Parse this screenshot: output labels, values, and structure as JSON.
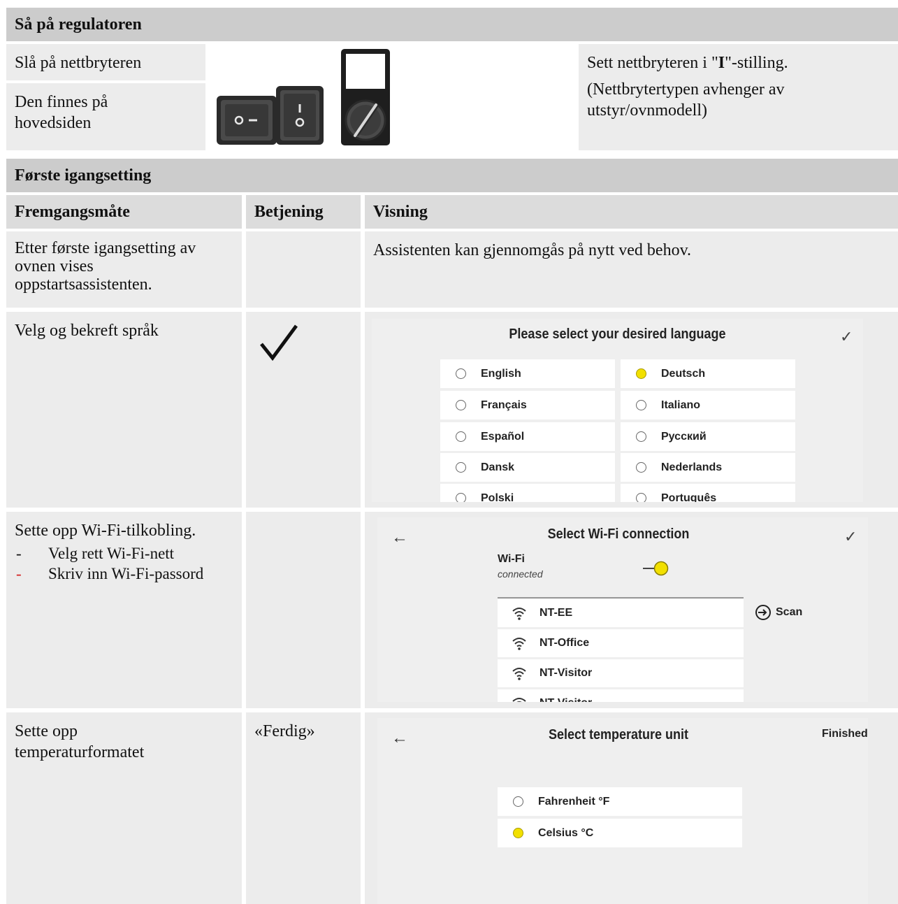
{
  "section1": {
    "header": "Så på regulatoren",
    "left_top": "Slå på nettbryteren",
    "left_bottom": "Den finnes på hovedsiden",
    "right_line1_pre": "Sett nettbryteren i \"",
    "right_line1_bold": "I",
    "right_line1_post": "\"-stilling.",
    "right_line2": "(Nettbrytertypen avhenger av utstyr/ovnmodell)"
  },
  "section2": {
    "header": "Første igangsetting",
    "columns": [
      "Fremgangsmåte",
      "Betjening",
      "Visning"
    ],
    "rows": {
      "intro": {
        "procedure": "Etter første igangsetting av ovnen vises oppstartsassistenten.",
        "display": "Assistenten kan gjennomgås på nytt ved behov."
      },
      "language": {
        "procedure": "Velg og bekreft språk",
        "operation_icon": "checkmark-icon"
      },
      "wifi": {
        "procedure": "Sette opp Wi-Fi-tilkobling.",
        "bullets": [
          "Velg rett Wi-Fi-nett",
          "Skriv inn Wi-Fi-passord"
        ],
        "bullet_marker": "-",
        "bullet_colors": [
          "#111111",
          "#d42020"
        ]
      },
      "temperature": {
        "procedure": "Sette opp temperaturformatet",
        "operation": "«Ferdig»"
      }
    }
  },
  "screen_language": {
    "title": "Please select your desired language",
    "confirm_icon": "check-icon",
    "options_left": [
      {
        "label": "English",
        "selected": false
      },
      {
        "label": "Français",
        "selected": false
      },
      {
        "label": "Español",
        "selected": false
      },
      {
        "label": "Dansk",
        "selected": false
      },
      {
        "label": "Polski",
        "selected": false
      }
    ],
    "options_right": [
      {
        "label": "Deutsch",
        "selected": true
      },
      {
        "label": "Italiano",
        "selected": false
      },
      {
        "label": "Русский",
        "selected": false
      },
      {
        "label": "Nederlands",
        "selected": false
      },
      {
        "label": "Português",
        "selected": false
      }
    ]
  },
  "screen_wifi": {
    "title": "Select Wi-Fi connection",
    "wifi_label": "Wi-Fi",
    "wifi_status": "connected",
    "scan_label": "Scan",
    "networks": [
      "NT-EE",
      "NT-Office",
      "NT-Visitor",
      "NT-Visitor"
    ]
  },
  "screen_temp": {
    "title": "Select temperature unit",
    "finished_label": "Finished",
    "options": [
      {
        "label": "Fahrenheit °F",
        "selected": false
      },
      {
        "label": "Celsius °C",
        "selected": true
      }
    ]
  },
  "colors": {
    "header_bg": "#cccccc",
    "cell_bg": "#ececec",
    "radio_selected": "#f2e000",
    "screen_bg": "#efefef"
  }
}
